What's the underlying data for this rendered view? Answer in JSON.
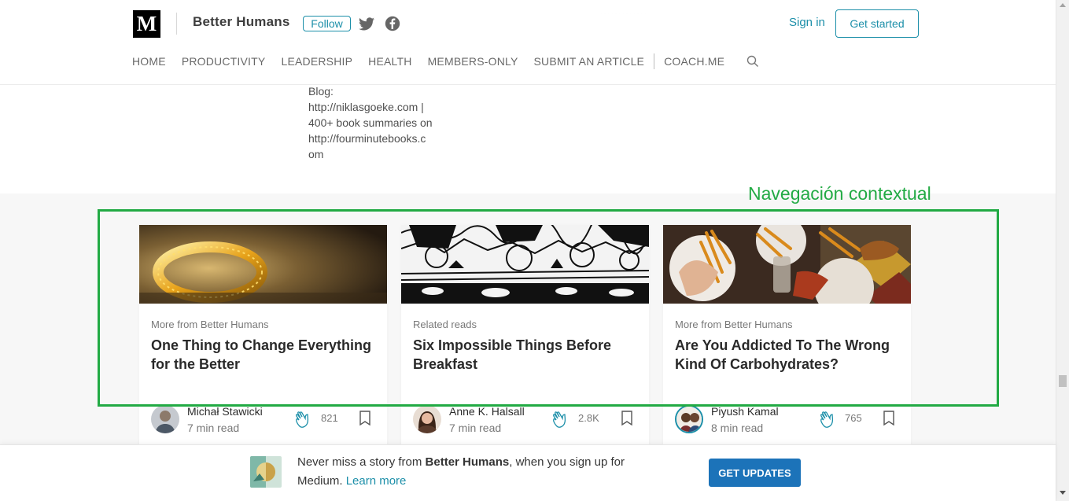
{
  "header": {
    "publication": "Better Humans",
    "follow_label": "Follow",
    "sign_in": "Sign in",
    "get_started": "Get started"
  },
  "nav": [
    "HOME",
    "PRODUCTIVITY",
    "LEADERSHIP",
    "HEALTH",
    "MEMBERS-ONLY",
    "SUBMIT AN ARTICLE",
    "COACH.ME"
  ],
  "author_bio": [
    "Blog:",
    "http://niklasgoeke.com |",
    "400+ book summaries on",
    "http://fourminutebooks.c",
    "om"
  ],
  "annotation": "Navegación contextual",
  "cards": [
    {
      "kicker": "More from Better Humans",
      "title": "One Thing to Change Everything for the Better",
      "author": "Michał Stawicki",
      "read_time": "7 min read",
      "claps": "821"
    },
    {
      "kicker": "Related reads",
      "title": "Six Impossible Things Before Breakfast",
      "author": "Anne K. Halsall",
      "read_time": "7 min read",
      "claps": "2.8K"
    },
    {
      "kicker": "More from Better Humans",
      "title": "Are You Addicted To The Wrong Kind Of Carbohydrates?",
      "author": "Piyush Kamal",
      "read_time": "8 min read",
      "claps": "765"
    }
  ],
  "banner": {
    "prefix": "Never miss a story from ",
    "pub": "Better Humans",
    "suffix": ", when you sign up for Medium. ",
    "learn_more": "Learn more",
    "button": "GET UPDATES"
  },
  "colors": {
    "accent": "#1c8fa9",
    "button_blue": "#1c73b9",
    "annotation_green": "#22aa44"
  }
}
